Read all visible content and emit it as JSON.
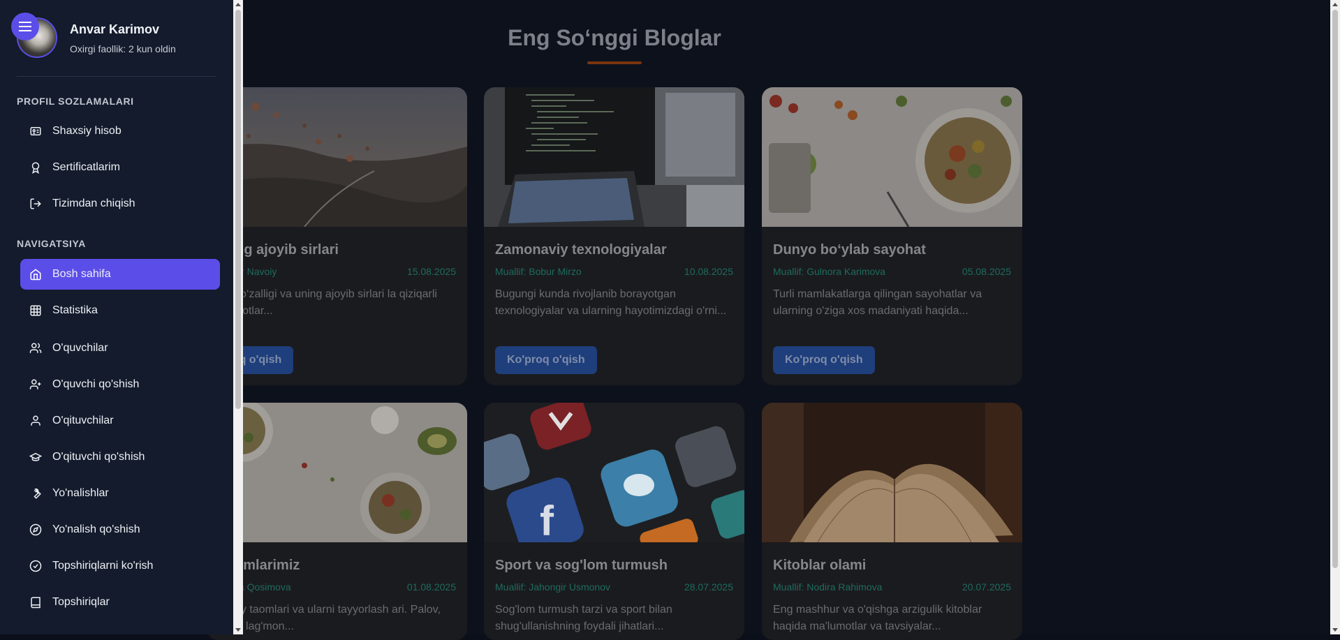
{
  "blog": {
    "heading": "Eng So‘nggi Bloglar",
    "cards": [
      {
        "title": "iatning ajoyib sirlari",
        "author": "f: Alisher Navoiy",
        "date": "15.08.2025",
        "desc": "tning go‘zalligi va uning ajoyib sirlari la qiziqarli ma'lumotlar...",
        "button": "'proq o'qish"
      },
      {
        "title": "Zamonaviy texnologiyalar",
        "author": "Muallif: Bobur Mirzo",
        "date": "10.08.2025",
        "desc": "Bugungi kunda rivojlanib borayotgan texnologiyalar va ularning hayotimizdagi o'rni...",
        "button": "Ko'proq o'qish"
      },
      {
        "title": "Dunyo bo‘ylab sayohat",
        "author": "Muallif: Gulnora Karimova",
        "date": "05.08.2025",
        "desc": "Turli mamlakatlarga qilingan sayohatlar va ularning o'ziga xos madaniyati haqida...",
        "button": "Ko'proq o'qish"
      },
      {
        "title": "iy taomlarimiz",
        "author": "f: Ziyoda Qosimova",
        "date": "01.08.2025",
        "desc": "ek milliy taomlari va ularni tayyorlash ari. Palov, somsa, lag'mon...",
        "button": ""
      },
      {
        "title": "Sport va sog'lom turmush",
        "author": "Muallif: Jahongir Usmonov",
        "date": "28.07.2025",
        "desc": "Sog'lom turmush tarzi va sport bilan shug'ullanishning foydali jihatlari...",
        "button": ""
      },
      {
        "title": "Kitoblar olami",
        "author": "Muallif: Nodira Rahimova",
        "date": "20.07.2025",
        "desc": "Eng mashhur va o'qishga arzigulik kitoblar haqida ma'lumotlar va tavsiyalar...",
        "button": ""
      }
    ]
  },
  "sidebar": {
    "user_name": "Anvar Karimov",
    "user_status": "Oxirgi faollik: 2 kun oldin",
    "profile_section": "PROFIL SOZLAMALARI",
    "profile_items": [
      {
        "label": "Shaxsiy hisob",
        "icon": "id-card-icon"
      },
      {
        "label": "Sertificatlarim",
        "icon": "award-icon"
      },
      {
        "label": "Tizimdan chiqish",
        "icon": "logout-icon"
      }
    ],
    "nav_section": "NAVIGATSIYA",
    "nav_items": [
      {
        "label": "Bosh sahifa",
        "icon": "home-icon",
        "active": true
      },
      {
        "label": "Statistika",
        "icon": "grid-table-icon"
      },
      {
        "label": "O'quvchilar",
        "icon": "users-icon"
      },
      {
        "label": "O'quvchi qo'shish",
        "icon": "user-plus-icon"
      },
      {
        "label": "O'qituvchilar",
        "icon": "user-icon"
      },
      {
        "label": "O'qituvchi qo'shish",
        "icon": "graduation-cap-icon"
      },
      {
        "label": "Yo'nalishlar",
        "icon": "wrench-icon"
      },
      {
        "label": "Yo'nalish qo'shish",
        "icon": "compass-icon"
      },
      {
        "label": "Topshiriqlarni ko'rish",
        "icon": "check-circle-icon"
      },
      {
        "label": "Topshiriqlar",
        "icon": "book-icon"
      }
    ]
  },
  "colors": {
    "accent": "#5b4ee8",
    "sidebar_bg": "#131b2c",
    "page_bg": "#0d111c",
    "heading_underline": "#7a3410"
  }
}
